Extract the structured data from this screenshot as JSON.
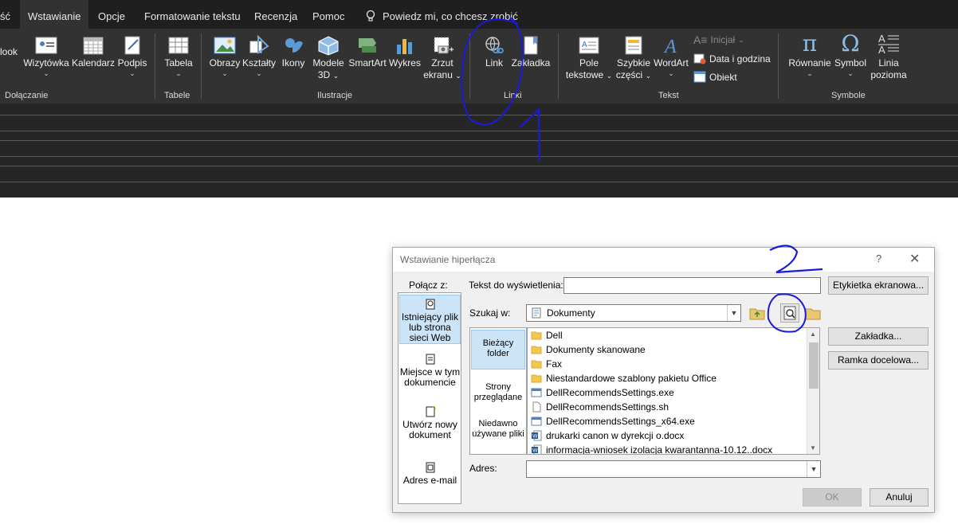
{
  "ribbon": {
    "tabs": [
      {
        "label": "ść"
      },
      {
        "label": "Wstawianie"
      },
      {
        "label": "Opcje"
      },
      {
        "label": "Formatowanie tekstu"
      },
      {
        "label": "Recenzja"
      },
      {
        "label": "Pomoc"
      }
    ],
    "tell_me": "Powiedz mi, co chcesz zrobić",
    "groups": {
      "include": "Dołączanie",
      "tables": "Tabele",
      "illustrations": "Ilustracje",
      "links": "Linki",
      "text": "Tekst",
      "symbols": "Symbole"
    },
    "buttons": {
      "outlook": "look",
      "business_card": "Wizytówka",
      "calendar": "Kalendarz",
      "signature": "Podpis",
      "table": "Tabela",
      "pictures": "Obrazy",
      "shapes": "Kształty",
      "icons": "Ikony",
      "models3d_line1": "Modele",
      "models3d_line2": "3D",
      "smartart": "SmartArt",
      "chart": "Wykres",
      "screenshot_line1": "Zrzut",
      "screenshot_line2": "ekranu",
      "link": "Link",
      "bookmark": "Zakładka",
      "textbox_line1": "Pole",
      "textbox_line2": "tekstowe",
      "quickparts_line1": "Szybkie",
      "quickparts_line2": "części",
      "wordart": "WordArt",
      "dropcap": "Inicjał",
      "datetime": "Data i godzina",
      "object": "Obiekt",
      "equation": "Równanie",
      "symbol": "Symbol",
      "hline_line1": "Linia",
      "hline_line2": "pozioma"
    }
  },
  "dialog": {
    "title": "Wstawianie hiperłącza",
    "help": "?",
    "close": "✕",
    "link_to_label": "Połącz z:",
    "link_to_items": [
      {
        "label": "Istniejący plik lub strona sieci Web"
      },
      {
        "label": "Miejsce w tym dokumencie"
      },
      {
        "label": "Utwórz nowy dokument"
      },
      {
        "label": "Adres e-mail"
      }
    ],
    "text_to_display_label": "Tekst do wyświetlenia:",
    "text_to_display_value": "",
    "screentip_button": "Etykietka ekranowa...",
    "look_in_label": "Szukaj w:",
    "look_in_value": "Dokumenty",
    "side_items": [
      {
        "label": "Bieżący folder"
      },
      {
        "label": "Strony przeglądane"
      },
      {
        "label": "Niedawno używane pliki"
      }
    ],
    "files": [
      {
        "name": "Dell",
        "type": "folder"
      },
      {
        "name": "Dokumenty skanowane",
        "type": "folder"
      },
      {
        "name": "Fax",
        "type": "folder"
      },
      {
        "name": "Niestandardowe szablony pakietu Office",
        "type": "folder"
      },
      {
        "name": "DellRecommendsSettings.exe",
        "type": "exe"
      },
      {
        "name": "DellRecommendsSettings.sh",
        "type": "file"
      },
      {
        "name": "DellRecommendsSettings_x64.exe",
        "type": "exe"
      },
      {
        "name": "drukarki canon w dyrekcji o.docx",
        "type": "docx"
      },
      {
        "name": "informacja-wniosek izolacja kwarantanna-10.12..docx",
        "type": "docx"
      }
    ],
    "bookmark_button": "Zakładka...",
    "target_frame_button": "Ramka docelowa...",
    "address_label": "Adres:",
    "address_value": "",
    "ok_button": "OK",
    "cancel_button": "Anuluj"
  },
  "colors": {
    "ribbon_bg": "#323232",
    "tabbar_bg": "#1f1f1f",
    "annotation_ink": "#1a1adc",
    "selection_bg": "#cce4f7"
  },
  "annotations": [
    "1",
    "2"
  ]
}
